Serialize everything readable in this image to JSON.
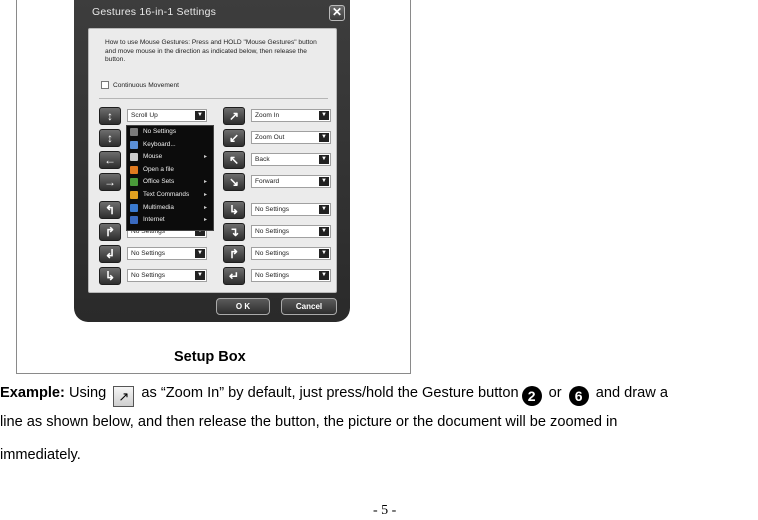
{
  "dialog": {
    "title": "Gestures 16-in-1 Settings",
    "close": "✕",
    "instructions": "How to use Mouse Gestures: Press and HOLD \"Mouse Gestures\" button and move mouse in the direction as indicated below, then release the button.",
    "continuous_movement": "Continuous Movement",
    "left_rows": [
      {
        "icon": "↕",
        "value": "Scroll Up"
      },
      {
        "icon": "↕",
        "value": ""
      },
      {
        "icon": "←",
        "value": ""
      },
      {
        "icon": "→",
        "value": ""
      },
      {
        "icon": "↰",
        "value": ""
      },
      {
        "icon": "↱",
        "value": "No Settings"
      },
      {
        "icon": "↲",
        "value": "No Settings"
      },
      {
        "icon": "↳",
        "value": "No Settings"
      }
    ],
    "right_rows": [
      {
        "icon": "↗",
        "value": "Zoom In"
      },
      {
        "icon": "↙",
        "value": "Zoom Out"
      },
      {
        "icon": "↖",
        "value": "Back"
      },
      {
        "icon": "↘",
        "value": "Forward"
      },
      {
        "icon": "↳",
        "value": "No Settings"
      },
      {
        "icon": "↴",
        "value": "No Settings"
      },
      {
        "icon": "↱",
        "value": "No Settings"
      },
      {
        "icon": "↵",
        "value": "No Settings"
      }
    ],
    "menu": [
      {
        "label": "No Settings",
        "submenu": false,
        "color": "#7a7a7a"
      },
      {
        "label": "Keyboard...",
        "submenu": false,
        "color": "#5a8fd6"
      },
      {
        "label": "Mouse",
        "submenu": true,
        "color": "#cccccc"
      },
      {
        "label": "Open a file",
        "submenu": false,
        "color": "#e07a1f"
      },
      {
        "label": "Office Sets",
        "submenu": true,
        "color": "#4a9a3a"
      },
      {
        "label": "Text Commands",
        "submenu": true,
        "color": "#e0a020"
      },
      {
        "label": "Multimedia",
        "submenu": true,
        "color": "#3a7ad0"
      },
      {
        "label": "Internet",
        "submenu": true,
        "color": "#3a6ac0"
      }
    ],
    "ok": "O K",
    "cancel": "Cancel"
  },
  "caption": "Setup Box",
  "paragraph": {
    "example_label": "Example:",
    "part1": "Using",
    "zoom_icon": "↗",
    "part2": "as “Zoom In” by default, just press/hold the Gesture button",
    "num2": "2",
    "or": "or",
    "num6": "6",
    "part3": "and draw a",
    "line2": "line as shown below, and then release the button, the picture or the document will be zoomed in",
    "line3": "immediately."
  },
  "page_number": "- 5 -"
}
